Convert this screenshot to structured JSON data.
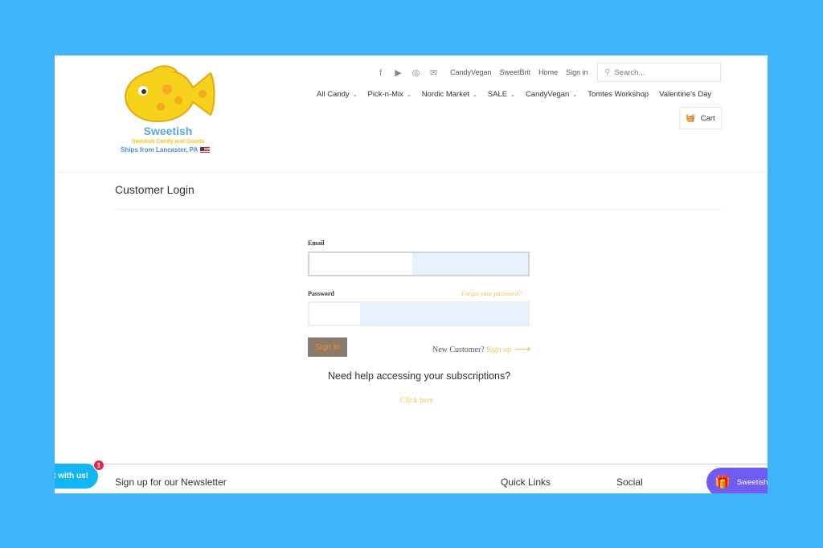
{
  "logo": {
    "brand": "Sweetish",
    "tagline": "Swedish Candy and Goods",
    "ships": "Ships from Lancaster, PA"
  },
  "social_icons": [
    "facebook-icon",
    "youtube-icon",
    "instagram-icon",
    "mail-icon"
  ],
  "top_links": [
    "CandyVegan",
    "SweetBrit",
    "Home",
    "Sign in"
  ],
  "search": {
    "placeholder": "Search..."
  },
  "main_nav": [
    {
      "label": "All Candy",
      "dropdown": true
    },
    {
      "label": "Pick-n-Mix",
      "dropdown": true
    },
    {
      "label": "Nordic Market",
      "dropdown": true
    },
    {
      "label": "SALE",
      "dropdown": true
    },
    {
      "label": "CandyVegan",
      "dropdown": true
    },
    {
      "label": "Tomtes Workshop",
      "dropdown": false
    },
    {
      "label": "Valentine's Day",
      "dropdown": false
    }
  ],
  "cart": {
    "label": "Cart"
  },
  "page_title": "Customer Login",
  "form": {
    "email_label": "Email",
    "email_value": "",
    "password_label": "Password",
    "password_value": "",
    "forgot": "Forgot your password?",
    "signin": "Sign In",
    "new_customer": "New Customer?",
    "signup": "Sign up"
  },
  "subscriptions": {
    "question": "Need help accessing your subscriptions?",
    "link": "Click here"
  },
  "footer": {
    "newsletter": "Sign up for our Newsletter",
    "quick_links": "Quick Links",
    "social": "Social"
  },
  "chat": {
    "label": "t with us!",
    "badge": "1"
  },
  "rewards": {
    "label": "Sweetish"
  },
  "colors": {
    "background": "#3fb4fb",
    "accent_gold": "#e8c65a",
    "signin_bg": "#8a7a6a",
    "signin_text": "#f09030",
    "chat": "#12b6f5",
    "rewards": "#6f5cf0"
  }
}
